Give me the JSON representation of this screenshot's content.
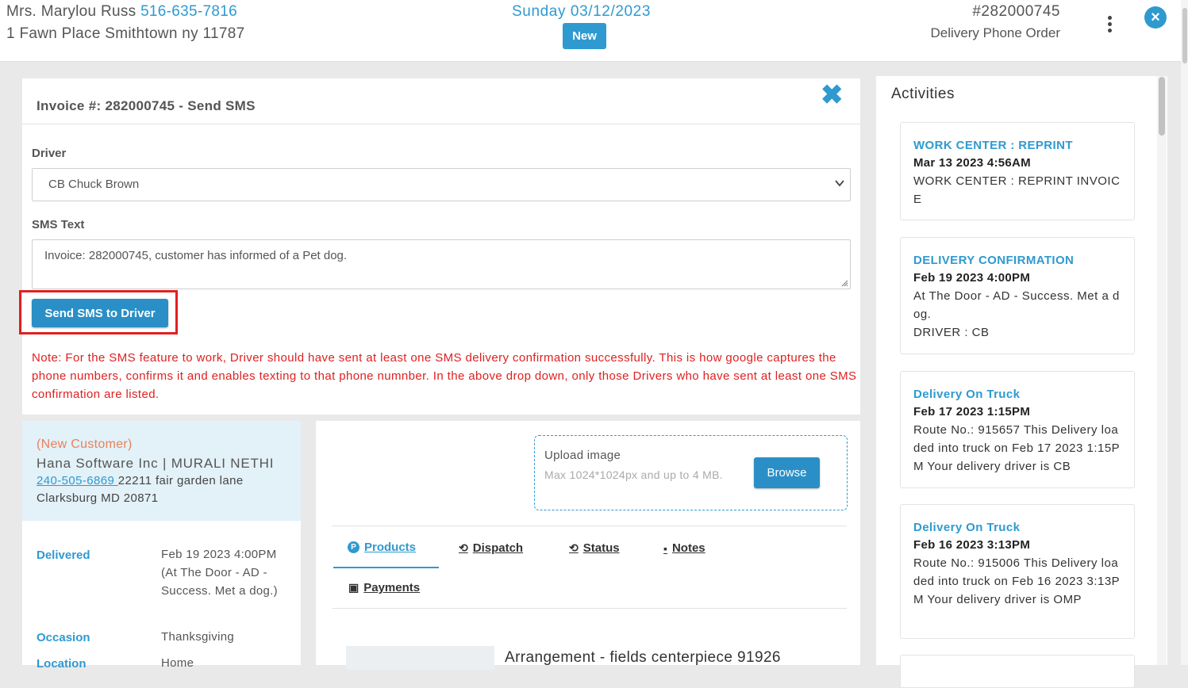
{
  "header": {
    "customer_name": "Mrs. Marylou Russ",
    "customer_phone": "516-635-7816",
    "customer_address": "1 Fawn Place Smithtown ny 11787",
    "date": "Sunday 03/12/2023",
    "status_badge": "New",
    "order_number": "#282000745",
    "order_type": "Delivery Phone Order",
    "menu_icon": "kebab-menu-icon",
    "close_icon": "close-circle-icon"
  },
  "sms_dialog": {
    "title": "Invoice #: 282000745 - Send SMS",
    "close_icon": "close-x-icon",
    "driver_label": "Driver",
    "driver_selected": "CB Chuck Brown",
    "sms_text_label": "SMS Text",
    "sms_text_value": "Invoice: 282000745, customer has informed of a Pet dog.",
    "send_button": "Send SMS to Driver",
    "note": "Note: For the SMS feature to work, Driver should have sent at least one SMS delivery confirmation successfully. This is how google captures the phone numbers, confirms it and enables texting to that phone numnber. In the above drop down, only those Drivers who have sent at least one SMS confirmation are listed."
  },
  "recipient": {
    "tag": "(New Customer)",
    "company": "Hana Software Inc | MURALI NETHI",
    "phone": "240-505-6869 ",
    "address": "22211 fair garden lane Clarksburg MD 20871",
    "fields": [
      {
        "label": "Delivered",
        "value": "Feb 19 2023 4:00PM (At The Door - AD - Success. Met a dog.)"
      },
      {
        "label": "Occasion",
        "value": "Thanksgiving"
      },
      {
        "label": "Location",
        "value": "Home"
      }
    ]
  },
  "details": {
    "upload_title": "Upload image",
    "upload_hint": "Max 1024*1024px and up to 4 MB.",
    "browse_button": "Browse",
    "tabs": [
      {
        "label": "Products",
        "icon": "products-p-icon"
      },
      {
        "label": "Dispatch",
        "icon": "history-icon"
      },
      {
        "label": "Status",
        "icon": "history-icon"
      },
      {
        "label": "Notes",
        "icon": "note-icon"
      },
      {
        "label": "Payments",
        "icon": "money-icon"
      }
    ],
    "product_title": "Arrangement - fields centerpiece 91926"
  },
  "activities": {
    "heading": "Activities",
    "items": [
      {
        "title": "WORK CENTER : REPRINT",
        "time": "Mar 13 2023 4:56AM",
        "body": "WORK CENTER : REPRINT INVOICE"
      },
      {
        "title": "DELIVERY CONFIRMATION",
        "time": "Feb 19 2023 4:00PM",
        "body": "At The Door - AD - Success. Met a dog.",
        "body2": "DRIVER : CB"
      },
      {
        "title": "Delivery On Truck",
        "time": "Feb 17 2023 1:15PM",
        "body": "Route No.: 915657 This Delivery loaded into truck on Feb 17 2023 1:15PM Your delivery driver is CB"
      },
      {
        "title": "Delivery On Truck",
        "time": "Feb 16 2023 3:13PM",
        "body": "Route No.: 915006 This Delivery loaded into truck on Feb 16 2023 3:13PM Your delivery driver is OMP"
      }
    ]
  },
  "colors": {
    "accent": "#2e9ad0",
    "warning": "#e02020",
    "highlight_border": "#e02020"
  }
}
